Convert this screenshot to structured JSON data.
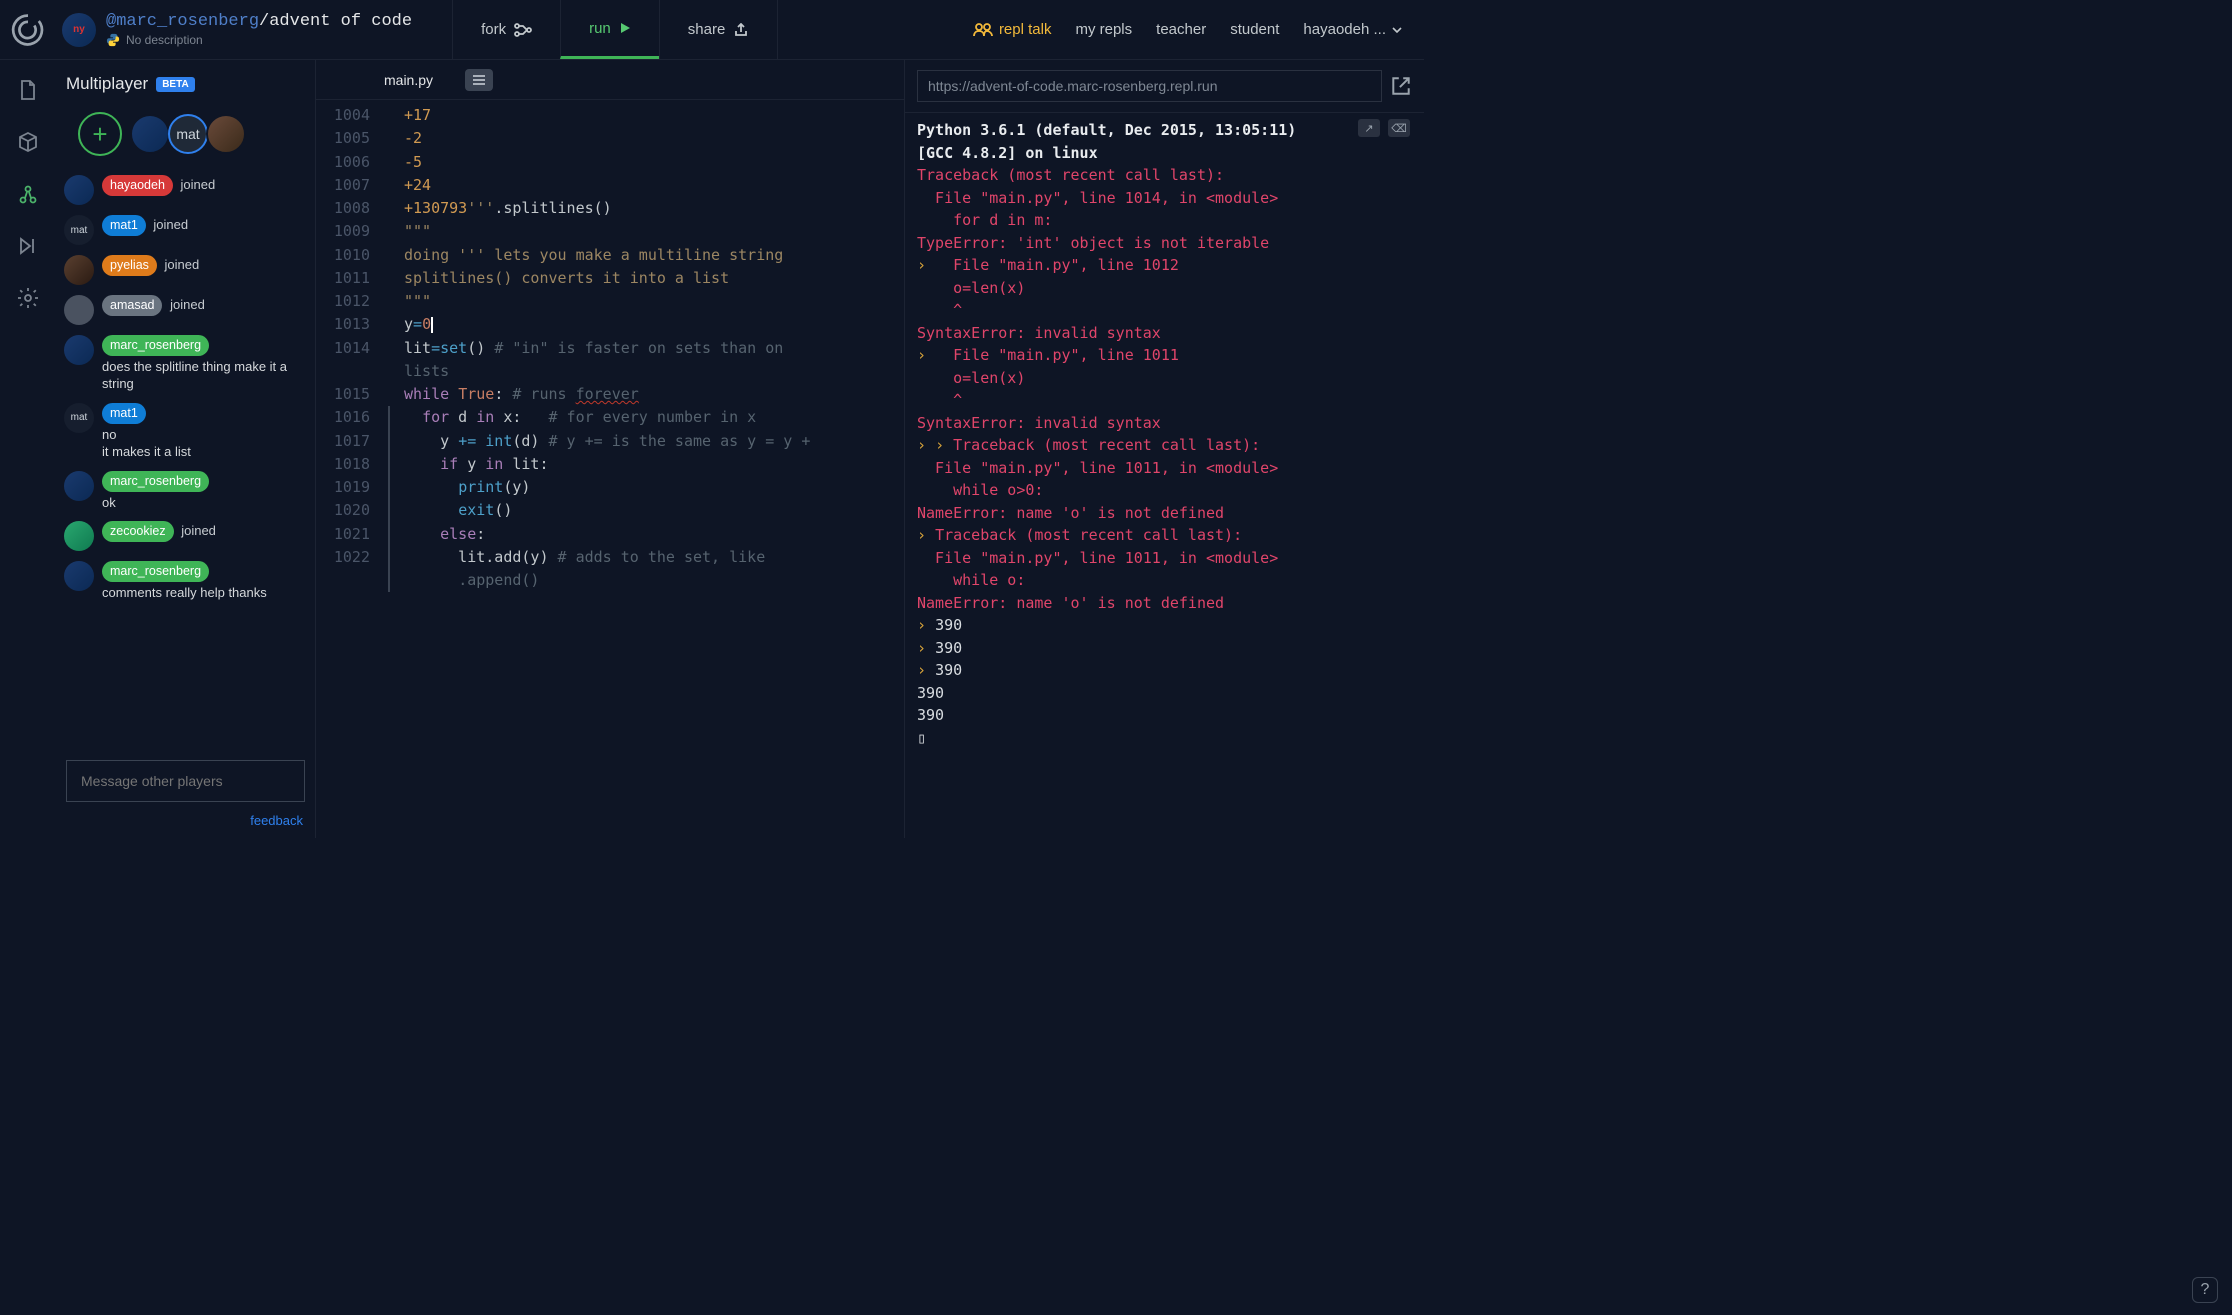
{
  "header": {
    "owner": "@marc_rosenberg",
    "repl_name": "advent of code",
    "subtitle": "No description",
    "tabs": {
      "fork": "fork",
      "run": "run",
      "share": "share"
    },
    "right": {
      "repl_talk": "repl talk",
      "my_repls": "my repls",
      "teacher": "teacher",
      "student": "student",
      "user": "hayaodeh ..."
    }
  },
  "sidebar": {
    "title": "Multiplayer",
    "badge": "BETA",
    "avatars_label_mat": "mat",
    "chat": [
      {
        "av": "giants",
        "pill": "red",
        "name": "hayaodeh",
        "type": "joined"
      },
      {
        "av": "mat",
        "pill": "blue",
        "name": "mat1",
        "type": "joined"
      },
      {
        "av": "brown",
        "pill": "orange",
        "name": "pyelias",
        "type": "joined"
      },
      {
        "av": "grey",
        "pill": "grey",
        "name": "amasad",
        "type": "joined"
      },
      {
        "av": "giants",
        "pill": "green",
        "name": "marc_rosenberg",
        "type": "msg",
        "msg": "does the splitline thing make it a string"
      },
      {
        "av": "mat",
        "pill": "blue",
        "name": "mat1",
        "type": "msg",
        "msg": "no\nit makes it a list"
      },
      {
        "av": "giants",
        "pill": "green",
        "name": "marc_rosenberg",
        "type": "msg",
        "msg": "ok"
      },
      {
        "av": "green",
        "pill": "green",
        "name": "zecookiez",
        "type": "joined"
      },
      {
        "av": "giants",
        "pill": "green",
        "name": "marc_rosenberg",
        "type": "msg",
        "msg": "comments really help thanks"
      }
    ],
    "msgbox_placeholder": "Message other players",
    "feedback": "feedback"
  },
  "editor": {
    "filename": "main.py",
    "lines": [
      {
        "n": 1004,
        "html": "<span class='c-orange'>+17</span>"
      },
      {
        "n": 1005,
        "html": "<span class='c-orange'>-2</span>"
      },
      {
        "n": 1006,
        "html": "<span class='c-orange'>-5</span>"
      },
      {
        "n": 1007,
        "html": "<span class='c-orange'>+24</span>"
      },
      {
        "n": 1008,
        "html": "<span class='c-orange'>+130793</span><span class='c-string'>'''</span>.splitlines()"
      },
      {
        "n": 1009,
        "html": "<span class='c-string'>\"\"\"</span>"
      },
      {
        "n": 1010,
        "html": "<span class='c-string'>doing ''' lets you make a multiline string</span>"
      },
      {
        "n": 1011,
        "html": "<span class='c-string'>splitlines() converts it into a list</span>"
      },
      {
        "n": 1012,
        "html": "<span class='c-string'>\"\"\"</span>"
      },
      {
        "n": 1013,
        "html": "y<span class='c-op'>=</span><span class='c-num'>0</span><span class='cursor-mark'></span>"
      },
      {
        "n": 1014,
        "html": "lit<span class='c-op'>=</span><span class='c-func'>set</span>() <span class='c-cmt'># \"in\" is faster on sets than on lists</span>",
        "wrap": true
      },
      {
        "n": 1015,
        "html": "<span class='c-kw'>while</span> <span class='c-bool'>True</span>: <span class='c-cmt'># runs <span class='wavy'>forever</span></span>"
      },
      {
        "n": 1016,
        "bar": true,
        "html": "  <span class='c-kw'>for</span> d <span class='c-kw'>in</span> x:   <span class='c-cmt'># for every number in x</span>"
      },
      {
        "n": 1017,
        "bar": true,
        "html": "    y <span class='c-op'>+=</span> <span class='c-func'>int</span>(d) <span class='c-cmt'># y += is the same as y = y +</span>"
      },
      {
        "n": 1018,
        "bar": true,
        "html": "    <span class='c-kw'>if</span> y <span class='c-kw'>in</span> lit:"
      },
      {
        "n": 1019,
        "bar": true,
        "html": "      <span class='c-func'>print</span>(y)"
      },
      {
        "n": 1020,
        "bar": true,
        "html": "      <span class='c-func'>exit</span>()"
      },
      {
        "n": 1021,
        "bar": true,
        "html": "    <span class='c-kw'>else</span>:"
      },
      {
        "n": 1022,
        "bar": true,
        "html": "      lit.add(y) <span class='c-cmt'># adds to the set, like .append()</span>",
        "wrap2": true
      }
    ]
  },
  "right": {
    "url": "https://advent-of-code.marc-rosenberg.repl.run",
    "console": [
      {
        "cls": "hdr",
        "t": "Python 3.6.1 (default, Dec 2015, 13:05:11)"
      },
      {
        "cls": "hdr",
        "t": "[GCC 4.8.2] on linux"
      },
      {
        "cls": "err",
        "t": "Traceback (most recent call last):"
      },
      {
        "cls": "err",
        "t": "  File \"main.py\", line 1014, in <module>"
      },
      {
        "cls": "err",
        "t": "    for d in m:"
      },
      {
        "cls": "err",
        "t": "TypeError: 'int' object is not iterable"
      },
      {
        "cls": "err",
        "pre": "1",
        "t": "  File \"main.py\", line 1012"
      },
      {
        "cls": "err",
        "t": "    o=len(x)"
      },
      {
        "cls": "err",
        "t": "    ^"
      },
      {
        "cls": "err",
        "t": "SyntaxError: invalid syntax"
      },
      {
        "cls": "err",
        "pre": "1",
        "t": "  File \"main.py\", line 1011"
      },
      {
        "cls": "err",
        "t": "    o=len(x)"
      },
      {
        "cls": "err",
        "t": "    ^"
      },
      {
        "cls": "err",
        "t": "SyntaxError: invalid syntax"
      },
      {
        "cls": "err",
        "pre": "2",
        "t": "Traceback (most recent call last):"
      },
      {
        "cls": "err",
        "t": "  File \"main.py\", line 1011, in <module>"
      },
      {
        "cls": "err",
        "t": "    while o>0:"
      },
      {
        "cls": "err",
        "t": "NameError: name 'o' is not defined"
      },
      {
        "cls": "err",
        "pre": "1",
        "t": "Traceback (most recent call last):"
      },
      {
        "cls": "err",
        "t": "  File \"main.py\", line 1011, in <module>"
      },
      {
        "cls": "err",
        "t": "    while o:"
      },
      {
        "cls": "err",
        "t": "NameError: name 'o' is not defined"
      },
      {
        "cls": "",
        "pre": "1",
        "t": "390"
      },
      {
        "cls": "",
        "pre": "1",
        "t": "390"
      },
      {
        "cls": "",
        "pre": "1",
        "t": "390"
      },
      {
        "cls": "",
        "t": "390"
      },
      {
        "cls": "",
        "t": "390"
      },
      {
        "cls": "",
        "t": "▯"
      }
    ]
  }
}
